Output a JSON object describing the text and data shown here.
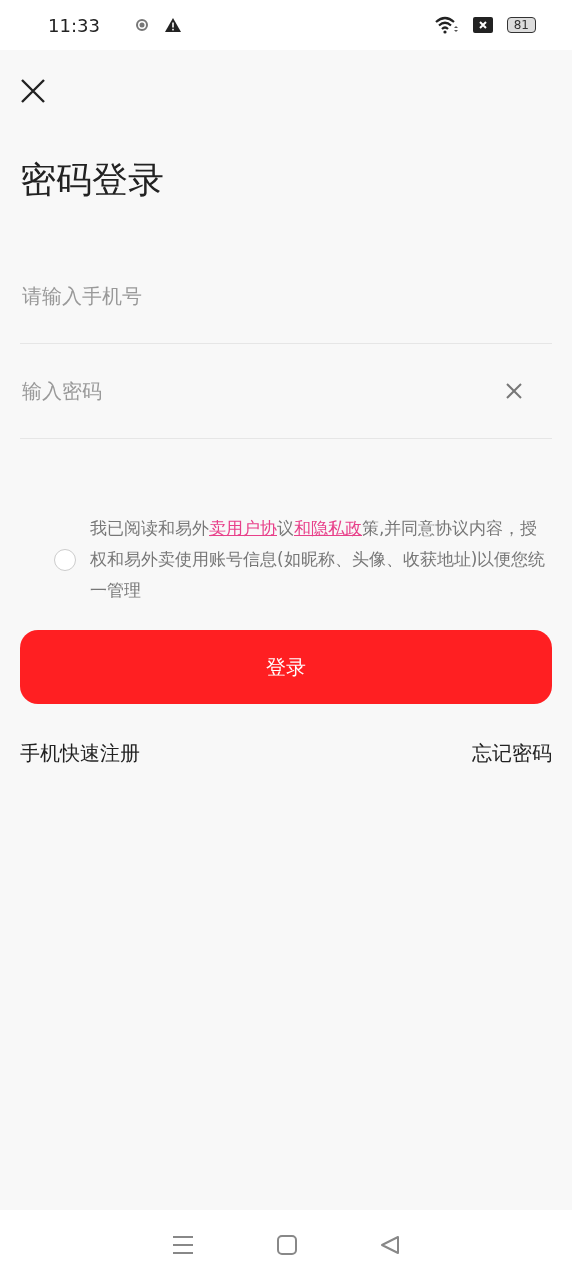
{
  "status_bar": {
    "time": "11:33",
    "battery": "81"
  },
  "title": "密码登录",
  "phone_field": {
    "placeholder": "请输入手机号"
  },
  "password_field": {
    "placeholder": "输入密码"
  },
  "agreement": {
    "checked": false,
    "parts": [
      {
        "kind": "text",
        "text": "我已阅读和易外"
      },
      {
        "kind": "link",
        "text": "卖用户协"
      },
      {
        "kind": "text",
        "text": "议"
      },
      {
        "kind": "link",
        "text": "和隐私政"
      },
      {
        "kind": "text",
        "text": "策,并同意协议内容，授权和易外卖使用账号信息(如昵称、头像、收获地址)以便您统一管理"
      }
    ]
  },
  "login_button": "登录",
  "links": [
    "手机快速注册",
    "忘记密码"
  ]
}
